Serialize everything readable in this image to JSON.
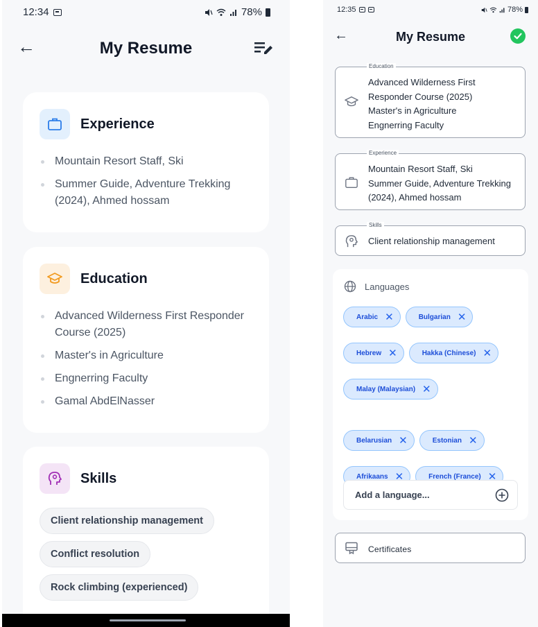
{
  "left": {
    "status": {
      "time": "12:34",
      "battery": "78%"
    },
    "appbar": {
      "title": "My Resume"
    },
    "experience": {
      "title": "Experience",
      "items": [
        "Mountain Resort Staff, Ski",
        "Summer Guide, Adventure Trekking (2024), Ahmed hossam"
      ]
    },
    "education": {
      "title": "Education",
      "items": [
        "Advanced Wilderness First Responder Course (2025)",
        "Master's in Agriculture",
        "Engnerring Faculty",
        "Gamal AbdElNasser"
      ]
    },
    "skills": {
      "title": "Skills",
      "items": [
        "Client relationship management",
        "Conflict resolution",
        "Rock climbing (experienced)"
      ]
    }
  },
  "right": {
    "status": {
      "time": "12:35",
      "battery": "78%"
    },
    "appbar": {
      "title": "My Resume"
    },
    "education": {
      "label": "Education",
      "text": "Advanced Wilderness First Responder Course (2025)\nMaster's in Agriculture\nEngnerring Faculty"
    },
    "experience": {
      "label": "Experience",
      "text": "Mountain Resort Staff, Ski\nSummer Guide, Adventure Trekking (2024), Ahmed hossam"
    },
    "skills": {
      "label": "Skills",
      "text": "Client relationship management"
    },
    "languages": {
      "title": "Languages",
      "items": [
        "Arabic",
        "Bulgarian",
        "Hebrew",
        "Hakka (Chinese)",
        "Malay (Malaysian)",
        "Belarusian",
        "Estonian",
        "Afrikaans",
        "French (France)"
      ],
      "add_placeholder": "Add a language..."
    },
    "certificates": {
      "label": "Certificates"
    }
  },
  "colors": {
    "accent_blue": "#1d4ed8",
    "success_green": "#22c55e",
    "chip_bg": "#dbeafe"
  }
}
